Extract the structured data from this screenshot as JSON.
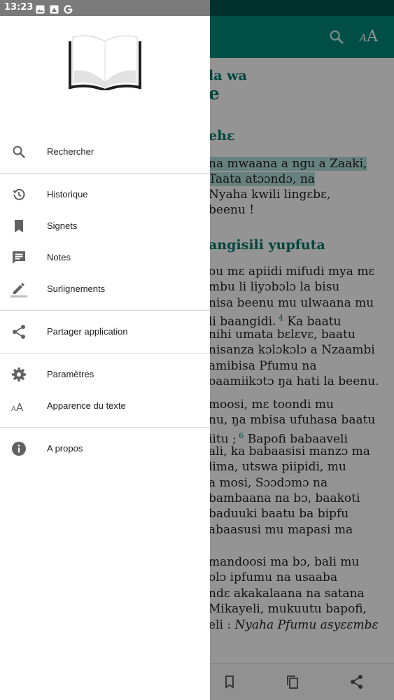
{
  "status_bar": {
    "time": "13:23",
    "icons": [
      "image-icon",
      "photo-icon",
      "google-icon"
    ]
  },
  "reader": {
    "lines": [
      {
        "text": "la wa",
        "style": "heading"
      },
      {
        "text": "e",
        "style": "title"
      },
      {
        "text": "ehɛ",
        "style": "heading"
      },
      {
        "text": "na mwaana a ngu a Zaaki,",
        "style": "highlight"
      },
      {
        "text": "Taata atɔɔndɔ, na",
        "style": "highlight"
      },
      {
        "text": "Nyaha kwili lingɛbɛ,",
        "style": "normal"
      },
      {
        "text": "beenu !",
        "style": "normal"
      },
      {
        "text": "angisili yupfuta",
        "style": "heading"
      },
      {
        "text": "ou mɛ apiidi mifudi mya mɛ",
        "style": "normal"
      },
      {
        "text": "mbu li liyɔbɔlɔ la bisu",
        "style": "normal"
      },
      {
        "text": "nisa beenu mu ulwaana mu",
        "style": "normal"
      },
      {
        "text": "li baangidi.",
        "verse": "4",
        "after": "Ka baatu",
        "style": "verse"
      },
      {
        "text": "nihi umata bɛlɛvɛ, baatu",
        "style": "normal"
      },
      {
        "text": "nisanza kɔlɔkɔlɔ a Nzaambi",
        "style": "normal"
      },
      {
        "text": "amibisa Pfumu na",
        "style": "normal"
      },
      {
        "text": "oaamiikɔtɔ ŋa hati la beenu.",
        "style": "normal"
      },
      {
        "text": "moosi, mɛ toondi mu",
        "style": "normal"
      },
      {
        "text": "nu, ŋa mbisa ufuhasa baatu",
        "style": "normal"
      },
      {
        "text": "iitu ;",
        "verse": "6",
        "after": "Bapofi babaaveli",
        "style": "verse"
      },
      {
        "text": "ali, ka babaasisi manzɔ ma",
        "style": "normal"
      },
      {
        "text": "lima, utswa piipidi, mu",
        "style": "normal"
      },
      {
        "text": "a mosi, Sɔɔdɔmɔ na",
        "style": "normal"
      },
      {
        "text": "bambaana na bɔ, baakoti",
        "style": "normal"
      },
      {
        "text": "baduuki baatu ba bipfu",
        "style": "normal"
      },
      {
        "text": "abaasusi mu mapasi ma",
        "style": "normal"
      },
      {
        "text": "mandoosi ma bɔ, bali mu",
        "style": "normal"
      },
      {
        "text": "olɔ ipfumu na usaaba",
        "style": "normal"
      },
      {
        "text": "ndɛ akakalaana na satana",
        "style": "normal"
      },
      {
        "text": "Mikayeli, mukuutu bapofi,",
        "style": "normal"
      },
      {
        "text": "eli : ",
        "after": "Nyaha Pfumu asyɛɛmbɛ",
        "style": "italic-after"
      }
    ]
  },
  "drawer": {
    "logo_icon": "open-book-icon",
    "items": [
      {
        "id": "search",
        "label": "Rechercher",
        "icon": "search-icon"
      },
      {
        "id": "history",
        "label": "Historique",
        "icon": "history-icon"
      },
      {
        "id": "bookmarks",
        "label": "Signets",
        "icon": "bookmark-icon"
      },
      {
        "id": "notes",
        "label": "Notes",
        "icon": "note-icon"
      },
      {
        "id": "highlights",
        "label": "Surlignements",
        "icon": "highlight-pen-icon"
      },
      {
        "id": "share-app",
        "label": "Partager application",
        "icon": "share-icon"
      },
      {
        "id": "settings",
        "label": "Paramètres",
        "icon": "gear-icon"
      },
      {
        "id": "text-appearance",
        "label": "Apparence du texte",
        "icon": "text-size-icon"
      },
      {
        "id": "about",
        "label": "A propos",
        "icon": "info-icon"
      }
    ]
  },
  "colors": {
    "primary": "#00897b",
    "primary_dark": "#00574b",
    "heading_text": "#00796b",
    "highlight": "#b2dfdb",
    "icon_grey": "#616161"
  }
}
